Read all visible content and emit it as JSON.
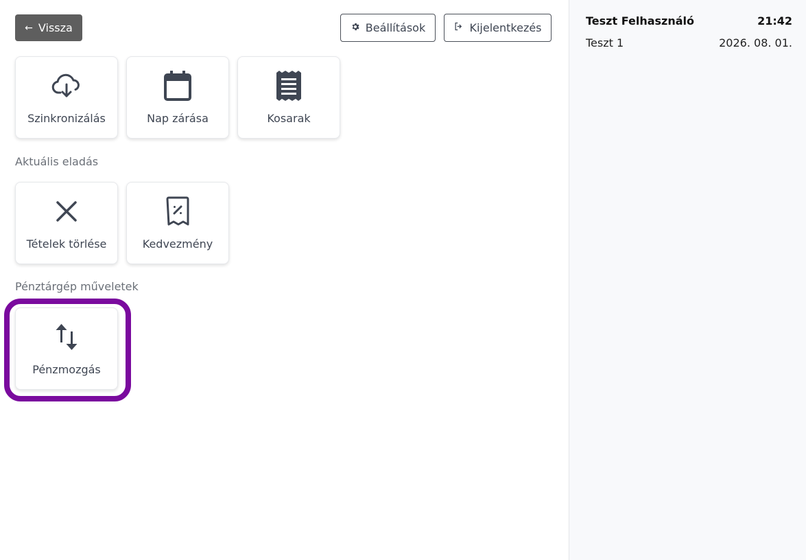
{
  "toolbar": {
    "back_label": "Vissza",
    "settings_label": "Beállítások",
    "logout_label": "Kijelentkezés"
  },
  "tiles_top": {
    "sync": "Szinkronizálás",
    "close_day": "Nap zárása",
    "baskets": "Kosarak"
  },
  "current_sale": {
    "heading": "Aktuális eladás",
    "delete_items": "Tételek törlése",
    "discount": "Kedvezmény"
  },
  "register_ops": {
    "heading": "Pénztárgép műveletek",
    "cash_movement": "Pénzmozgás"
  },
  "sidebar": {
    "user_name": "Teszt Felhasználó",
    "time": "21:42",
    "terminal": "Teszt 1",
    "date": "2026. 08. 01."
  },
  "colors": {
    "back_button": "#5e5e5e",
    "highlight": "#7a0a9e",
    "icon": "#3f4653"
  }
}
